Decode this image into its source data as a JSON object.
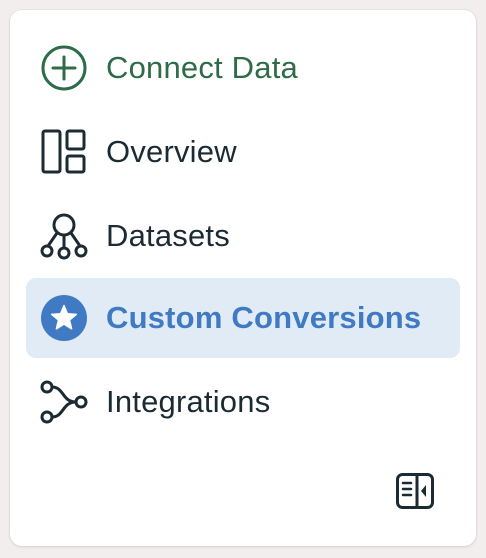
{
  "sidebar": {
    "items": [
      {
        "label": "Connect Data",
        "icon": "plus-circle-icon",
        "color": "#2e6b49",
        "active": false
      },
      {
        "label": "Overview",
        "icon": "layout-icon",
        "active": false
      },
      {
        "label": "Datasets",
        "icon": "dataset-graph-icon",
        "active": false
      },
      {
        "label": "Custom Conversions",
        "icon": "star-circle-icon",
        "color": "#3f7ac2",
        "active": true
      },
      {
        "label": "Integrations",
        "icon": "integrations-icon",
        "active": false
      }
    ],
    "collapse_icon": "collapse-sidebar-icon"
  },
  "colors": {
    "connect_green": "#2e6b49",
    "active_blue": "#3f7ac2",
    "active_bg": "#e0ebf6",
    "text": "#1c2b33"
  }
}
